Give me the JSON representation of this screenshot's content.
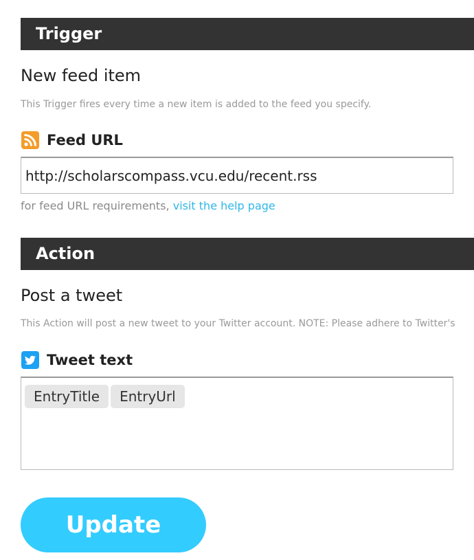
{
  "trigger": {
    "header": "Trigger",
    "title": "New feed item",
    "description": "This Trigger fires every time a new item is added to the feed you specify.",
    "field_label": "Feed URL",
    "field_icon": "rss-icon",
    "feed_url_value": "http://scholarscompass.vcu.edu/recent.rss",
    "help_prefix": "for feed URL requirements, ",
    "help_link": "visit the help page"
  },
  "action": {
    "header": "Action",
    "title": "Post a tweet",
    "description": "This Action will post a new tweet to your Twitter account. NOTE: Please adhere to Twitter's",
    "field_label": "Tweet text",
    "field_icon": "twitter-icon",
    "tokens": [
      "EntryTitle",
      "EntryUrl"
    ]
  },
  "update_button": "Update",
  "colors": {
    "section_bar": "#333333",
    "link": "#2fb7e8",
    "button": "#33ccff",
    "rss": "#f39c2a",
    "twitter": "#1da1f2"
  }
}
